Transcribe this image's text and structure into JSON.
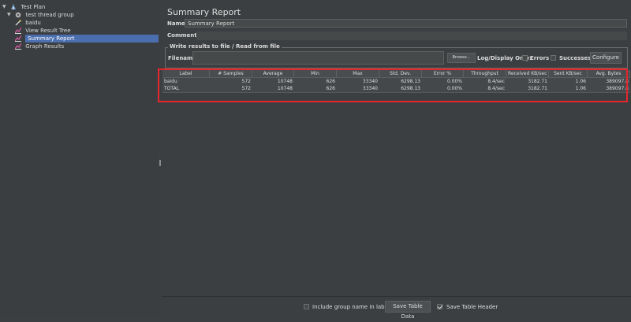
{
  "tree": {
    "items": [
      {
        "label": "Test Plan",
        "icon": "test-plan-icon"
      },
      {
        "label": "test thread group",
        "icon": "thread-group-icon"
      },
      {
        "label": "baidu",
        "icon": "http-sampler-icon"
      },
      {
        "label": "View Result Tree",
        "icon": "listener-icon"
      },
      {
        "label": "Summary Report",
        "icon": "listener-icon",
        "selected": true
      },
      {
        "label": "Graph Results",
        "icon": "listener-icon"
      }
    ]
  },
  "panel": {
    "title": "Summary Report",
    "name_label": "Name:",
    "name_value": "Summary Report",
    "comments_label": "Comments:"
  },
  "write_results": {
    "legend": "Write results to file / Read from file",
    "filename_label": "Filename",
    "browse_label": "Browse...",
    "log_display_label": "Log/Display Only:",
    "errors_label": "Errors",
    "successes_label": "Successes",
    "configure_label": "Configure"
  },
  "table": {
    "columns": [
      "Label",
      "# Samples",
      "Average",
      "Min",
      "Max",
      "Std. Dev.",
      "Error %",
      "Throughput",
      "Received KB/sec",
      "Sent KB/sec",
      "Avg. Bytes"
    ],
    "rows": [
      [
        "baidu",
        "572",
        "10748",
        "626",
        "33340",
        "6298.13",
        "0.00%",
        "8.4/sec",
        "3182.71",
        "1.06",
        "389097.8"
      ],
      [
        "TOTAL",
        "572",
        "10748",
        "626",
        "33340",
        "6298.13",
        "0.00%",
        "8.4/sec",
        "3182.71",
        "1.06",
        "389097.8"
      ]
    ]
  },
  "bottom": {
    "include_group_label": "Include group name in label?",
    "save_table_data_label": "Save Table Data",
    "save_table_header_label": "Save Table Header",
    "save_table_header_checked": true
  },
  "colors": {
    "background": "#3c3f41",
    "selection": "#4b6eaf",
    "highlight_border": "#e5262d"
  }
}
